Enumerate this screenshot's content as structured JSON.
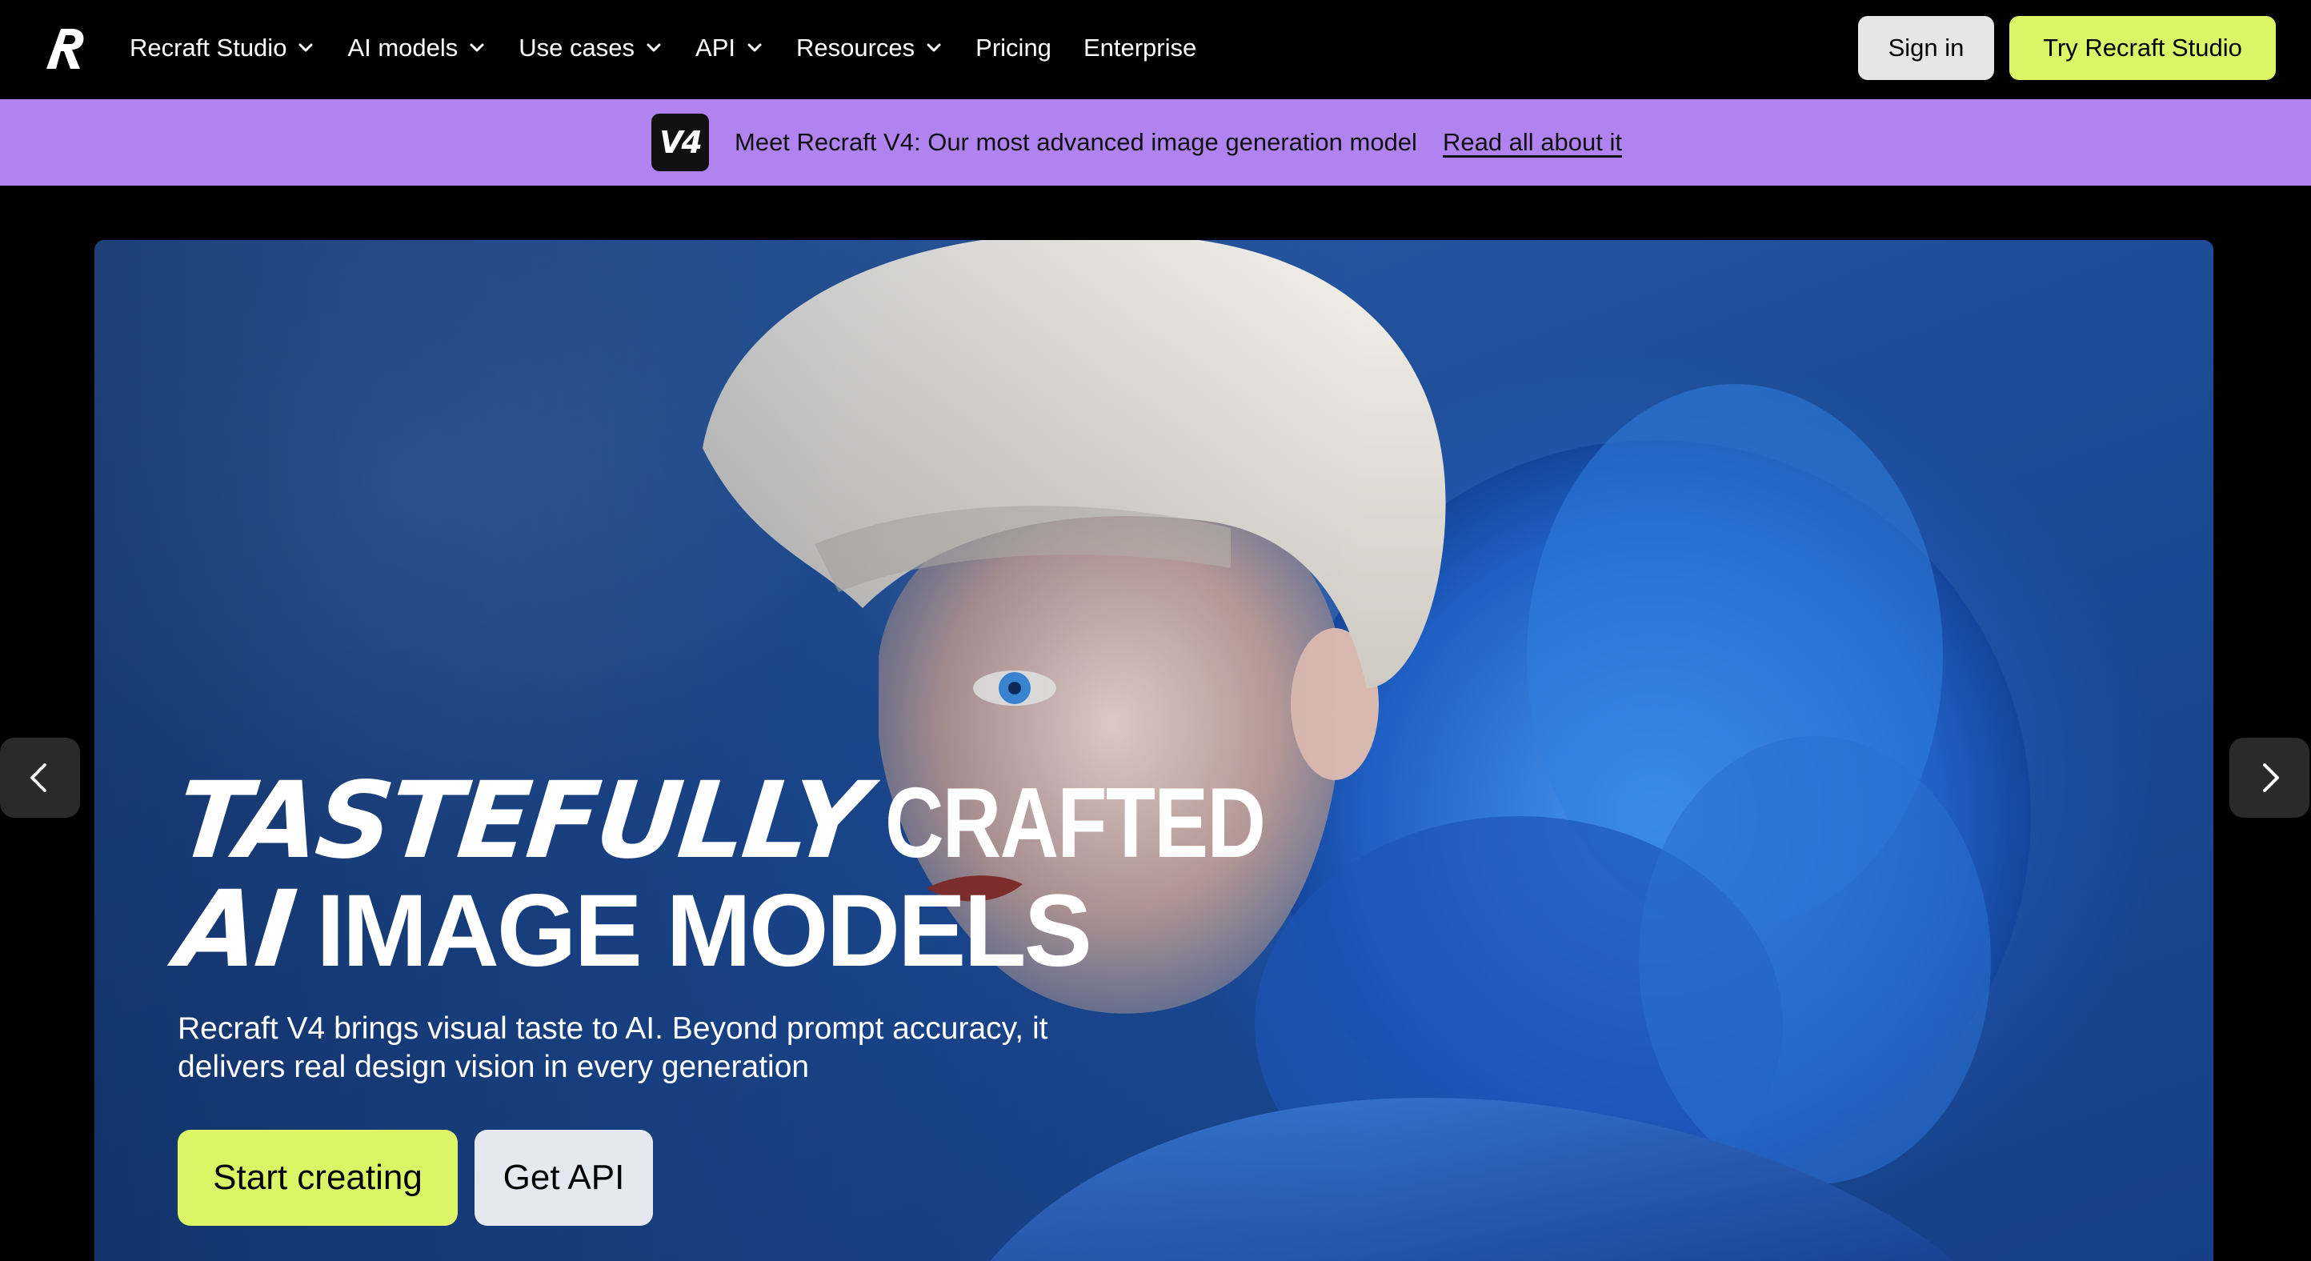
{
  "nav": {
    "logo_icon": "recraft-logo-icon",
    "menu": [
      {
        "label": "Recraft Studio",
        "dropdown": true
      },
      {
        "label": "AI models",
        "dropdown": true
      },
      {
        "label": "Use cases",
        "dropdown": true
      },
      {
        "label": "API",
        "dropdown": true
      },
      {
        "label": "Resources",
        "dropdown": true
      },
      {
        "label": "Pricing",
        "dropdown": false
      },
      {
        "label": "Enterprise",
        "dropdown": false
      }
    ],
    "sign_in": "Sign in",
    "try_button": "Try Recraft Studio"
  },
  "banner": {
    "badge": "V4",
    "text": "Meet Recraft V4: Our most advanced image generation model",
    "link": "Read all about it",
    "background": "#b083f0"
  },
  "hero": {
    "headline": {
      "line1_italic": "TASTEFULLY",
      "line1_condensed": "CRAFTED",
      "line2_italic": "AI",
      "line2_bold": "IMAGE MODELS"
    },
    "subtitle": "Recraft V4 brings visual taste to AI. Beyond prompt accuracy, it delivers real design vision in every generation",
    "cta_primary": "Start creating",
    "cta_secondary": "Get API",
    "image_description_icon": "portrait-blue-ruffle-image",
    "prev_icon": "chevron-left-icon",
    "next_icon": "chevron-right-icon"
  },
  "colors": {
    "accent_lime": "#dcf567",
    "banner_purple": "#b083f0",
    "hero_blue": "#1c4c96"
  }
}
